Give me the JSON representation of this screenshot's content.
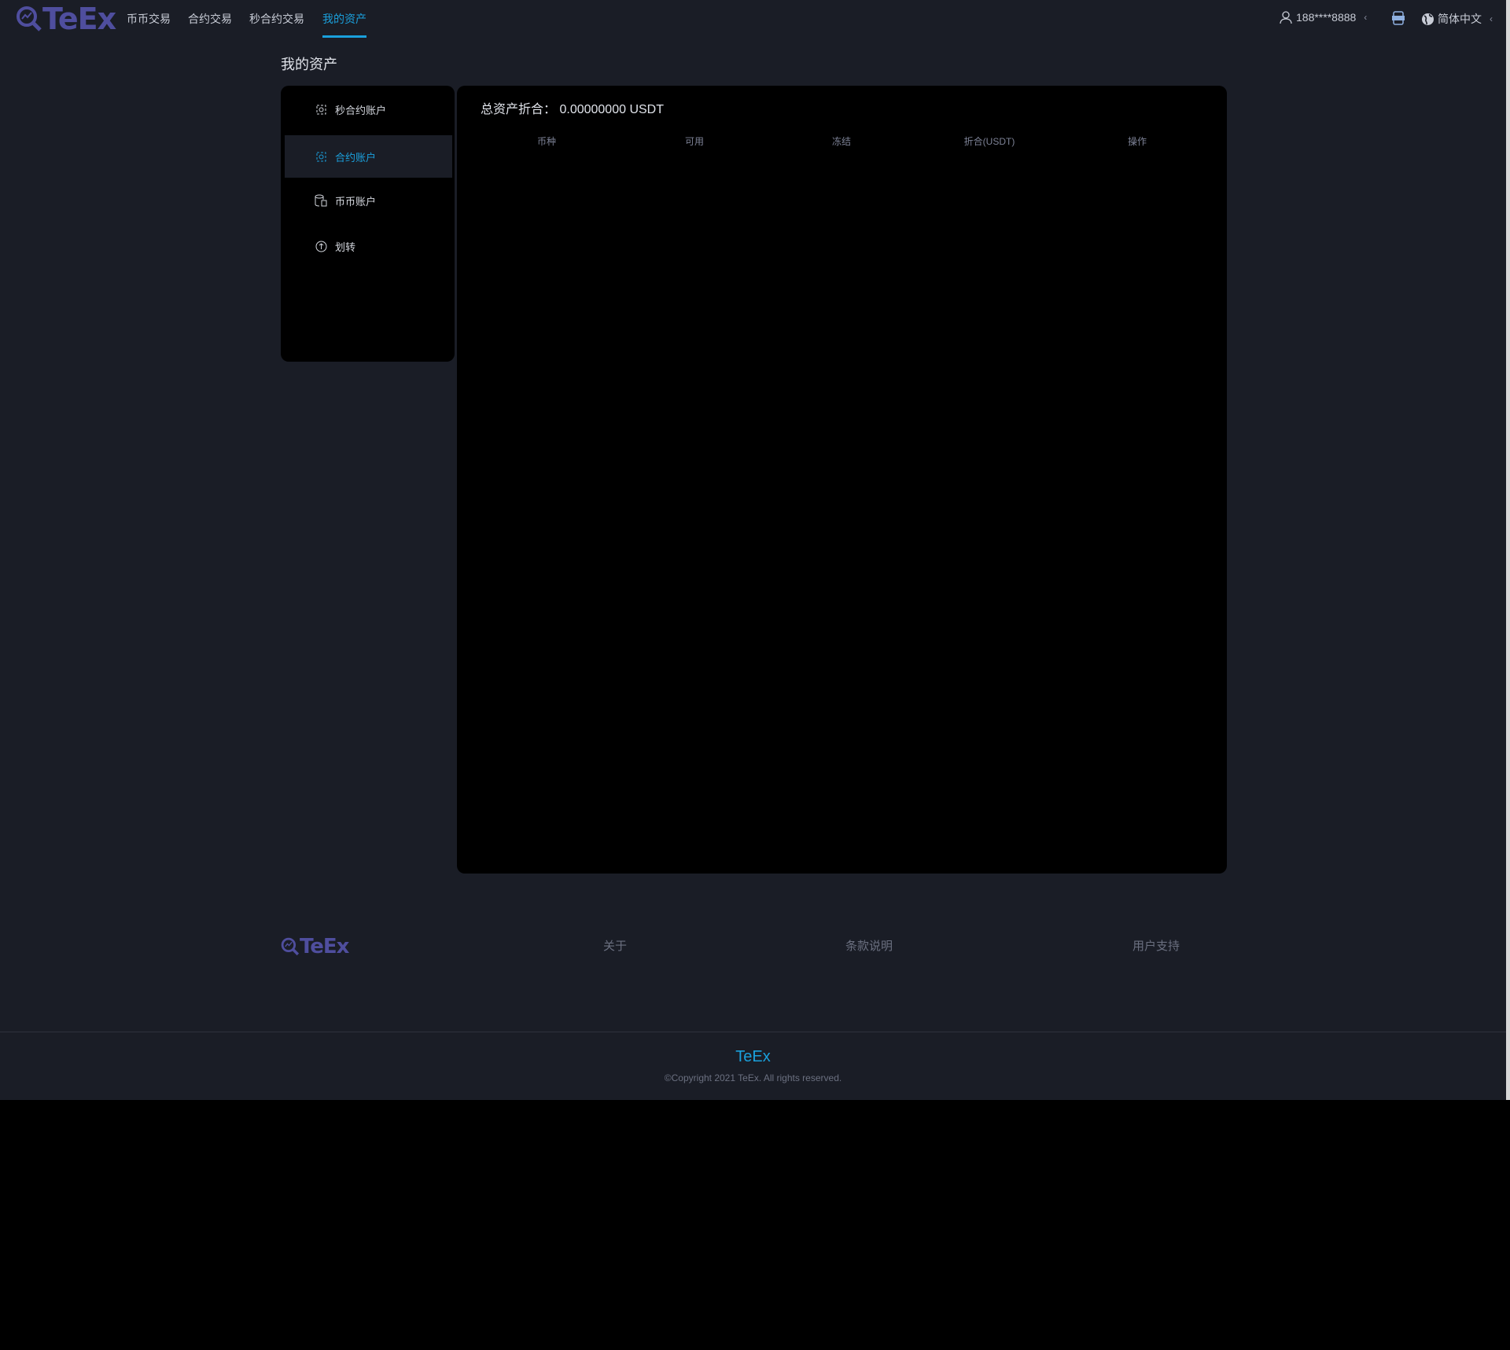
{
  "header": {
    "logo": "TeEx",
    "nav": [
      {
        "label": "币币交易"
      },
      {
        "label": "合约交易"
      },
      {
        "label": "秒合约交易"
      },
      {
        "label": "我的资产",
        "active": true
      }
    ],
    "user": "188****8888",
    "app_icon": "APP",
    "language": "简体中文"
  },
  "page_title": "我的资产",
  "sidebar": {
    "items": [
      {
        "label": "秒合约账户",
        "icon": "contract-icon"
      },
      {
        "label": "合约账户",
        "icon": "contract-icon",
        "active": true
      },
      {
        "label": "币币账户",
        "icon": "database-icon"
      },
      {
        "label": "划转",
        "icon": "transfer-icon"
      }
    ]
  },
  "main": {
    "total_label": "总资产折合：",
    "total_value": "0.00000000 USDT",
    "columns": [
      "币种",
      "可用",
      "冻结",
      "折合(USDT)",
      "操作"
    ]
  },
  "footer": {
    "logo": "TeEx",
    "links": [
      "关于",
      "条款说明",
      "用户支持"
    ],
    "brand": "TeEx",
    "copyright": "©Copyright 2021 TeEx. All rights reserved."
  },
  "colors": {
    "accent": "#1aa0dc",
    "logo": "#4f4e9e",
    "background": "#1a1d26",
    "panel": "#000000"
  }
}
